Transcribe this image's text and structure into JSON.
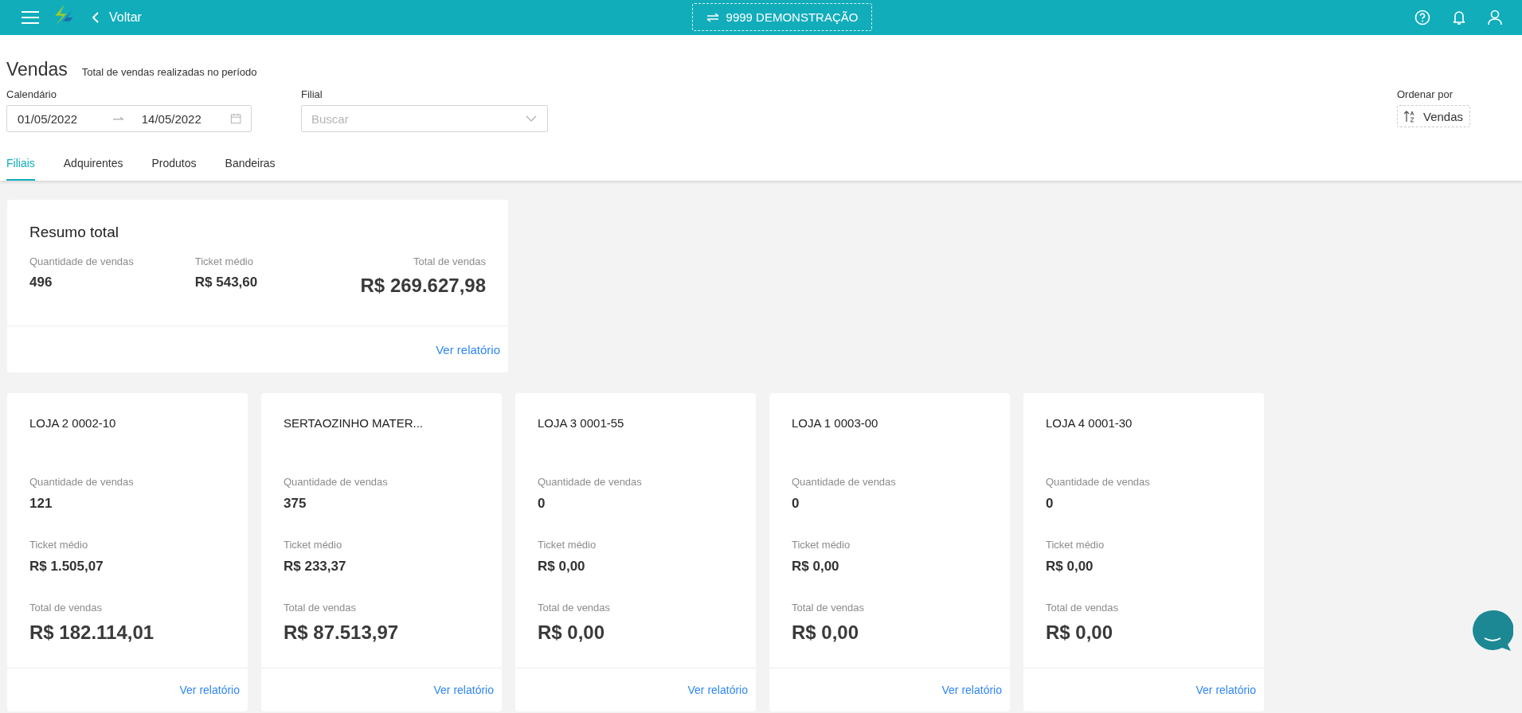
{
  "topbar": {
    "back_label": "Voltar",
    "company": "9999 DEMONSTRAÇÃO"
  },
  "header": {
    "title": "Vendas",
    "subtitle": "Total de vendas realizadas no período"
  },
  "filters": {
    "calendar": {
      "label": "Calendário",
      "start": "01/05/2022",
      "end": "14/05/2022"
    },
    "branch": {
      "label": "Filial",
      "placeholder": "Buscar"
    },
    "sort": {
      "label": "Ordenar por",
      "value": "Vendas"
    }
  },
  "tabs": [
    {
      "label": "Filiais",
      "selected": true
    },
    {
      "label": "Adquirentes",
      "selected": false
    },
    {
      "label": "Produtos",
      "selected": false
    },
    {
      "label": "Bandeiras",
      "selected": false
    }
  ],
  "summary": {
    "title": "Resumo total",
    "qty_label": "Quantidade de vendas",
    "qty": "496",
    "ticket_label": "Ticket médio",
    "ticket": "R$ 543,60",
    "total_label": "Total de vendas",
    "total": "R$ 269.627,98",
    "link": "Ver relatório"
  },
  "stores": [
    {
      "name": "LOJA 2 0002-10",
      "qty_label": "Quantidade de vendas",
      "qty": "121",
      "ticket_label": "Ticket médio",
      "ticket": "R$ 1.505,07",
      "total_label": "Total de vendas",
      "total": "R$ 182.114,01",
      "link": "Ver relatório"
    },
    {
      "name": "SERTAOZINHO MATER...",
      "qty_label": "Quantidade de vendas",
      "qty": "375",
      "ticket_label": "Ticket médio",
      "ticket": "R$ 233,37",
      "total_label": "Total de vendas",
      "total": "R$ 87.513,97",
      "link": "Ver relatório"
    },
    {
      "name": "LOJA 3 0001-55",
      "qty_label": "Quantidade de vendas",
      "qty": "0",
      "ticket_label": "Ticket médio",
      "ticket": "R$ 0,00",
      "total_label": "Total de vendas",
      "total": "R$ 0,00",
      "link": "Ver relatório"
    },
    {
      "name": "LOJA 1 0003-00",
      "qty_label": "Quantidade de vendas",
      "qty": "0",
      "ticket_label": "Ticket médio",
      "ticket": "R$ 0,00",
      "total_label": "Total de vendas",
      "total": "R$ 0,00",
      "link": "Ver relatório"
    },
    {
      "name": "LOJA 4 0001-30",
      "qty_label": "Quantidade de vendas",
      "qty": "0",
      "ticket_label": "Ticket médio",
      "ticket": "R$ 0,00",
      "total_label": "Total de vendas",
      "total": "R$ 0,00",
      "link": "Ver relatório"
    }
  ]
}
